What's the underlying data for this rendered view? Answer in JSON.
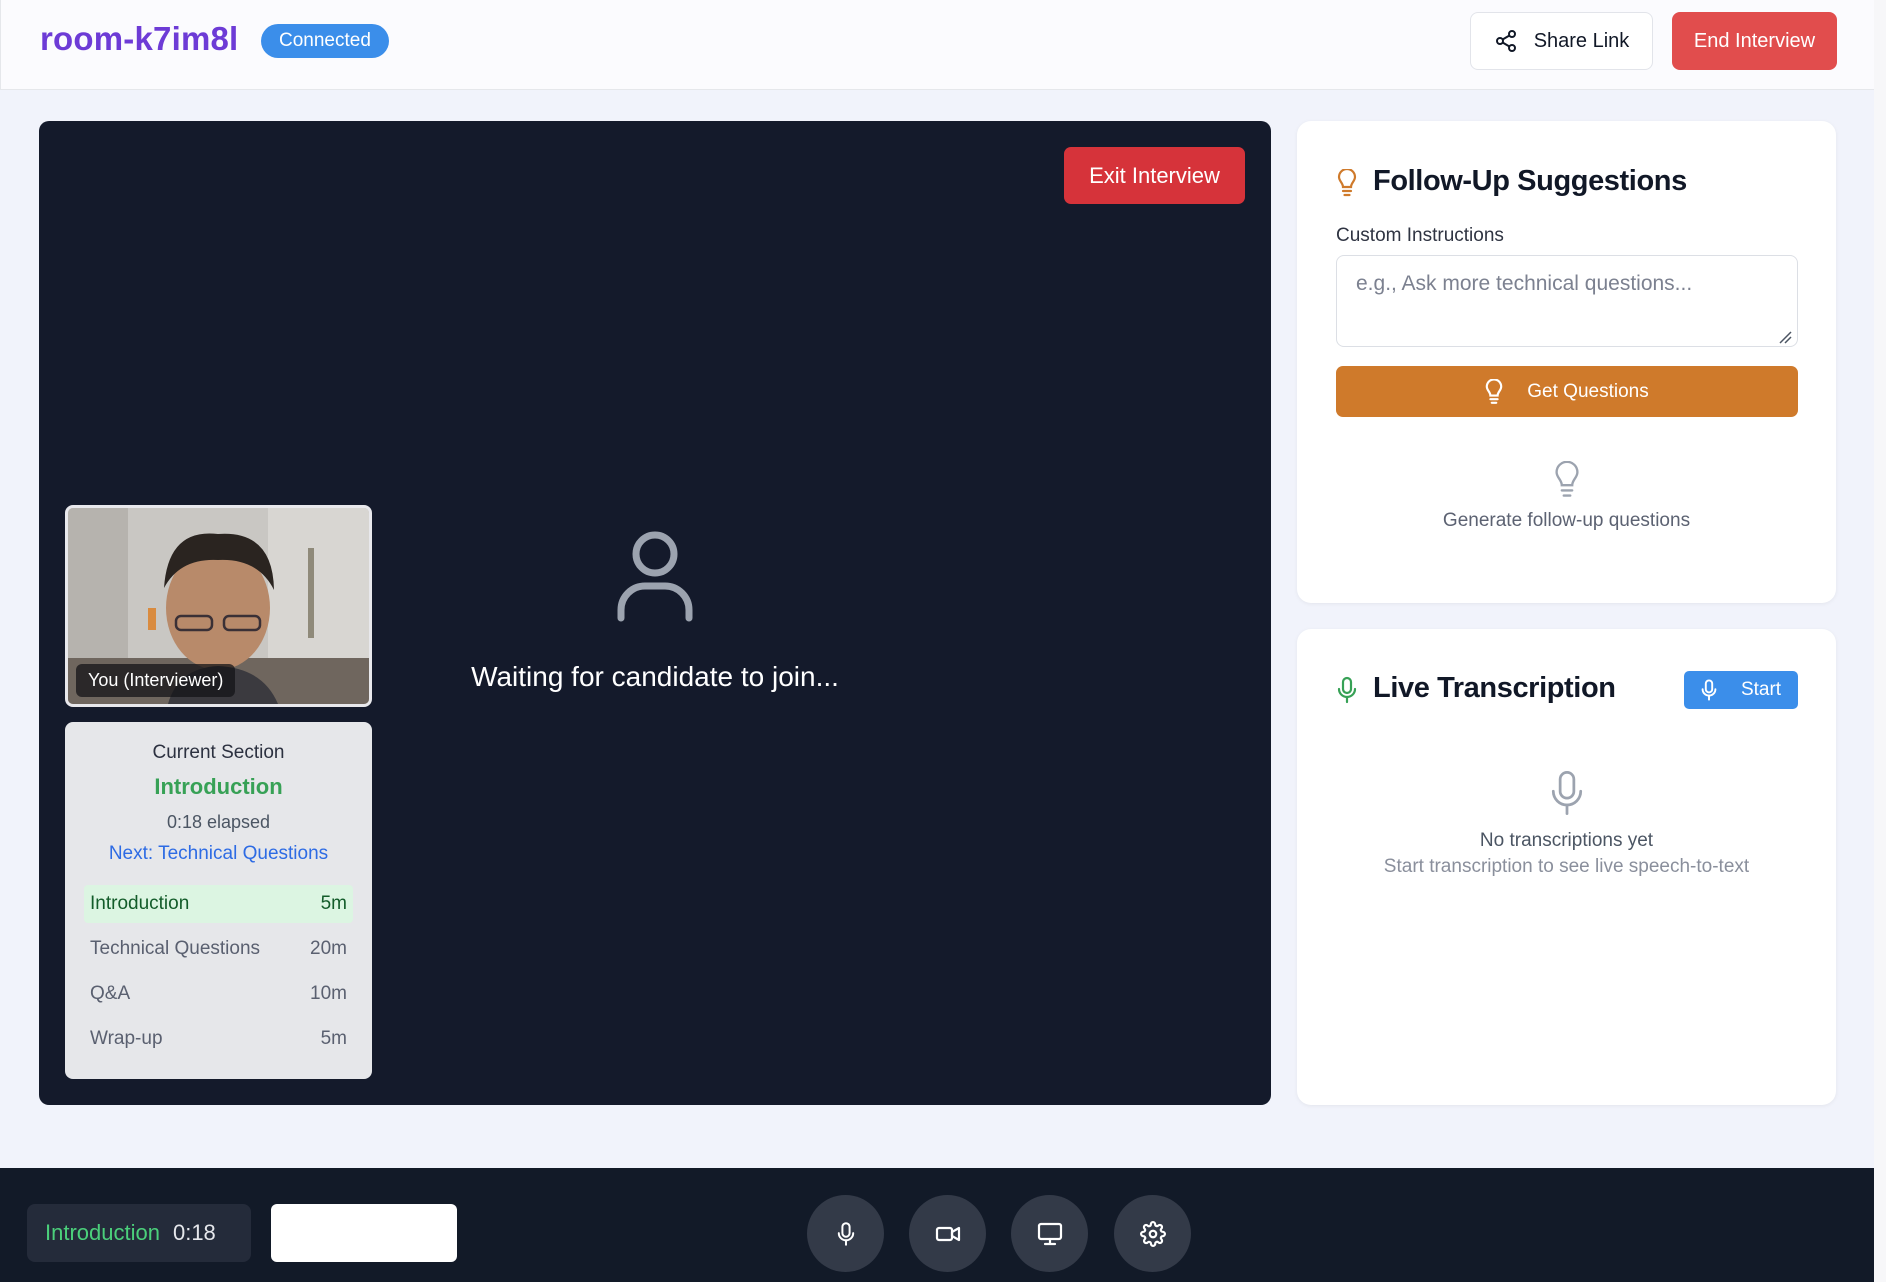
{
  "header": {
    "room_title": "room-k7im8l",
    "status_badge": "Connected",
    "share_label": "Share Link",
    "end_label": "End Interview"
  },
  "video": {
    "exit_label": "Exit Interview",
    "self_label": "You (Interviewer)",
    "waiting_text": "Waiting for candidate to join..."
  },
  "section_panel": {
    "caption": "Current Section",
    "current": "Introduction",
    "elapsed": "0:18 elapsed",
    "next": "Next: Technical Questions",
    "agenda": [
      {
        "name": "Introduction",
        "duration": "5m"
      },
      {
        "name": "Technical Questions",
        "duration": "20m"
      },
      {
        "name": "Q&A",
        "duration": "10m"
      },
      {
        "name": "Wrap-up",
        "duration": "5m"
      }
    ]
  },
  "suggestions": {
    "title": "Follow-Up Suggestions",
    "instructions_label": "Custom Instructions",
    "instructions_placeholder": "e.g., Ask more technical questions...",
    "instructions_value": "",
    "button_label": "Get Questions",
    "empty_text": "Generate follow-up questions"
  },
  "transcription": {
    "title": "Live Transcription",
    "start_label": "Start",
    "empty_title": "No transcriptions yet",
    "empty_subtitle": "Start transcription to see live speech-to-text"
  },
  "bottom_bar": {
    "section_name": "Introduction",
    "section_time": "0:18",
    "controls": [
      "microphone-icon",
      "camera-icon",
      "screen-share-icon",
      "settings-icon"
    ]
  },
  "colors": {
    "brand": "#6d3bd6",
    "connected": "#3b8eea",
    "danger": "#e14d4d",
    "suggest_accent": "#cf7a2b",
    "success": "#37a156",
    "stage": "#141a2b"
  }
}
